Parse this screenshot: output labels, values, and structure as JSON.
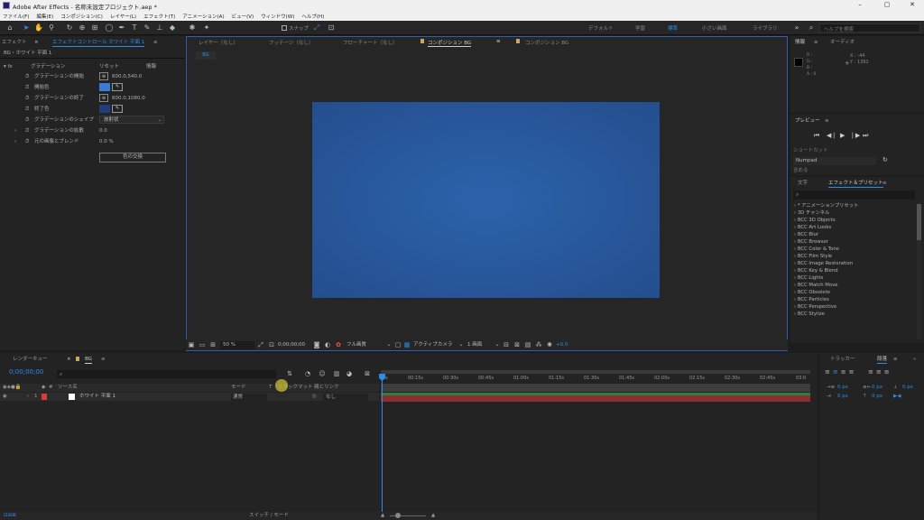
{
  "window": {
    "title": "Adobe After Effects - 名称未設定プロジェクト.aep *",
    "minimize": "–",
    "maximize": "▢",
    "close": "✕"
  },
  "menu": [
    "ファイル(F)",
    "編集(E)",
    "コンポジション(C)",
    "レイヤー(L)",
    "エフェクト(T)",
    "アニメーション(A)",
    "ビュー(V)",
    "ウィンドウ(W)",
    "ヘルプ(H)"
  ],
  "toolbar": {
    "snap_label": "スナップ",
    "workspaces": [
      "デフォルト",
      "学習",
      "標準",
      "小さい画面",
      "ライブラリ"
    ],
    "search_placeholder": "ヘルプを検索"
  },
  "effect_controls": {
    "tab_left": "エフェクト",
    "tab_title": "エフェクトコントロール ホワイト 平面 1",
    "layer_path": "BG・ホワイト 平面 1",
    "effect_name": "グラデーション",
    "reset": "リセット",
    "about": "情報",
    "rows": [
      {
        "label": "グラデーションの開始",
        "value": "800.0,540.0"
      },
      {
        "label": "開始色",
        "value": ""
      },
      {
        "label": "グラデーションの終了",
        "value": "800.0,1080.0"
      },
      {
        "label": "終了色",
        "value": ""
      },
      {
        "label": "グラデーションのシェイプ",
        "value": "放射状"
      },
      {
        "label": "グラデーションの拡散",
        "value": "0.0"
      },
      {
        "label": "元の画像とブレンド",
        "value": "0.0 %"
      }
    ],
    "swap_button": "色の交換",
    "start_color": "#3a7bd5",
    "end_color": "#1f3e7a"
  },
  "comp_viewer": {
    "tabs": [
      "レイヤー（なし）",
      "フッテージ（なし）",
      "フローチャート（なし）",
      "コンポジション BG",
      "コンポジション BG"
    ],
    "sub_tab": "BG",
    "zoom": "50 %",
    "timecode": "0;00;00;00",
    "resolution": "フル画質",
    "camera": "アクティブカメラ",
    "views": "1 画面",
    "exposure": "+0.0",
    "canvas_center": "#2d62ab",
    "canvas_edge": "#244e8e"
  },
  "info_panel": {
    "tab1": "情報",
    "tab2": "オーディオ",
    "r": "R :",
    "g": "G :",
    "b": "B :",
    "a": "A : 0",
    "x": "X : -44",
    "y": "Y : 1392"
  },
  "preview_panel": {
    "title": "プレビュー",
    "shortcut_label": "ショートカット",
    "shortcut_value": "Numpad",
    "include_label": "含める"
  },
  "effects_presets": {
    "tab1": "文字",
    "tab2": "エフェクト＆プリセット",
    "items": [
      "* アニメーションプリセット",
      "3D チャンネル",
      "BCC 3D Objects",
      "BCC Art Looks",
      "BCC Blur",
      "BCC Browser",
      "BCC Color & Tone",
      "BCC Film Style",
      "BCC Image Restoration",
      "BCC Key & Blend",
      "BCC Lights",
      "BCC Match Move",
      "BCC Obsolete",
      "BCC Particles",
      "BCC Perspective",
      "BCC Stylize"
    ]
  },
  "timeline": {
    "tab_render": "レンダーキュー",
    "tab_comp": "BG",
    "timecode": "0;00;00;00",
    "col_source": "ソース名",
    "col_mode": "モード",
    "col_t": "T",
    "col_trkmat": "トラックマット",
    "col_parent": "親とリンク",
    "layer_num": "1",
    "layer_name": "ホワイト 平面 1",
    "layer_mode": "通常",
    "layer_parent": "なし",
    "switch_label": "スイッチ / モード",
    "ruler": [
      "0s",
      "00:15s",
      "00:30s",
      "00:45s",
      "01:00s",
      "01:15s",
      "01:30s",
      "01:45s",
      "02:00s",
      "02:15s",
      "02:30s",
      "02:45s",
      "03:0"
    ]
  },
  "align_panel": {
    "tab1": "トラッカー",
    "tab2": "段落",
    "px": "0 px"
  }
}
